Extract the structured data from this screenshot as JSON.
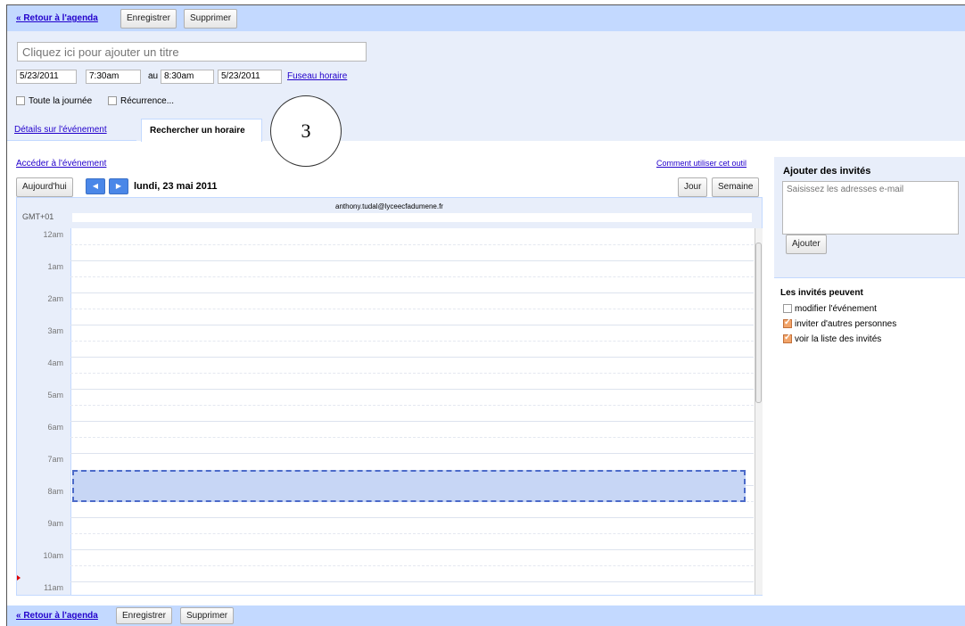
{
  "toolbar": {
    "back_label": "« Retour à l'agenda",
    "save_label": "Enregistrer",
    "delete_label": "Supprimer"
  },
  "event": {
    "title_placeholder": "Cliquez ici pour ajouter un titre",
    "start_date": "5/23/2011",
    "start_time": "7:30am",
    "to_label": "au",
    "end_time": "8:30am",
    "end_date": "5/23/2011",
    "timezone_link": "Fuseau horaire",
    "all_day_label": "Toute la journée",
    "recurrence_label": "Récurrence..."
  },
  "tabs": [
    {
      "label": "Détails sur l'événement",
      "active": false
    },
    {
      "label": "Rechercher un horaire",
      "active": true
    }
  ],
  "annotation_number": "3",
  "schedule": {
    "go_to_event": "Accéder à l'événement",
    "how_to_link": "Comment utiliser cet outil",
    "today_button": "Aujourd'hui",
    "prev_icon": "arrow-left-icon",
    "next_icon": "arrow-right-icon",
    "current_date": "lundi, 23 mai 2011",
    "day_view": "Jour",
    "week_view": "Semaine",
    "attendee_email": "anthony.tudal@lyceecfadumene.fr",
    "timezone": "GMT+01",
    "hours": [
      "12am",
      "1am",
      "2am",
      "3am",
      "4am",
      "5am",
      "6am",
      "7am",
      "8am",
      "9am",
      "10am",
      "11am"
    ],
    "event_start": "7:30am",
    "event_end": "8:30am"
  },
  "guests": {
    "title": "Ajouter des invités",
    "input_placeholder": "Saisissez les adresses e-mail",
    "add_button": "Ajouter",
    "permissions_title": "Les invités peuvent",
    "permissions": [
      {
        "label": "modifier l'événement",
        "checked": false
      },
      {
        "label": "inviter d'autres personnes",
        "checked": true
      },
      {
        "label": "voir la liste des invités",
        "checked": true
      }
    ]
  },
  "colors": {
    "header_blue": "#c3d9ff",
    "panel_light": "#e8eefa",
    "event_fill": "#c7d6f5",
    "event_border": "#4b6ac9",
    "link": "#2200cc"
  }
}
